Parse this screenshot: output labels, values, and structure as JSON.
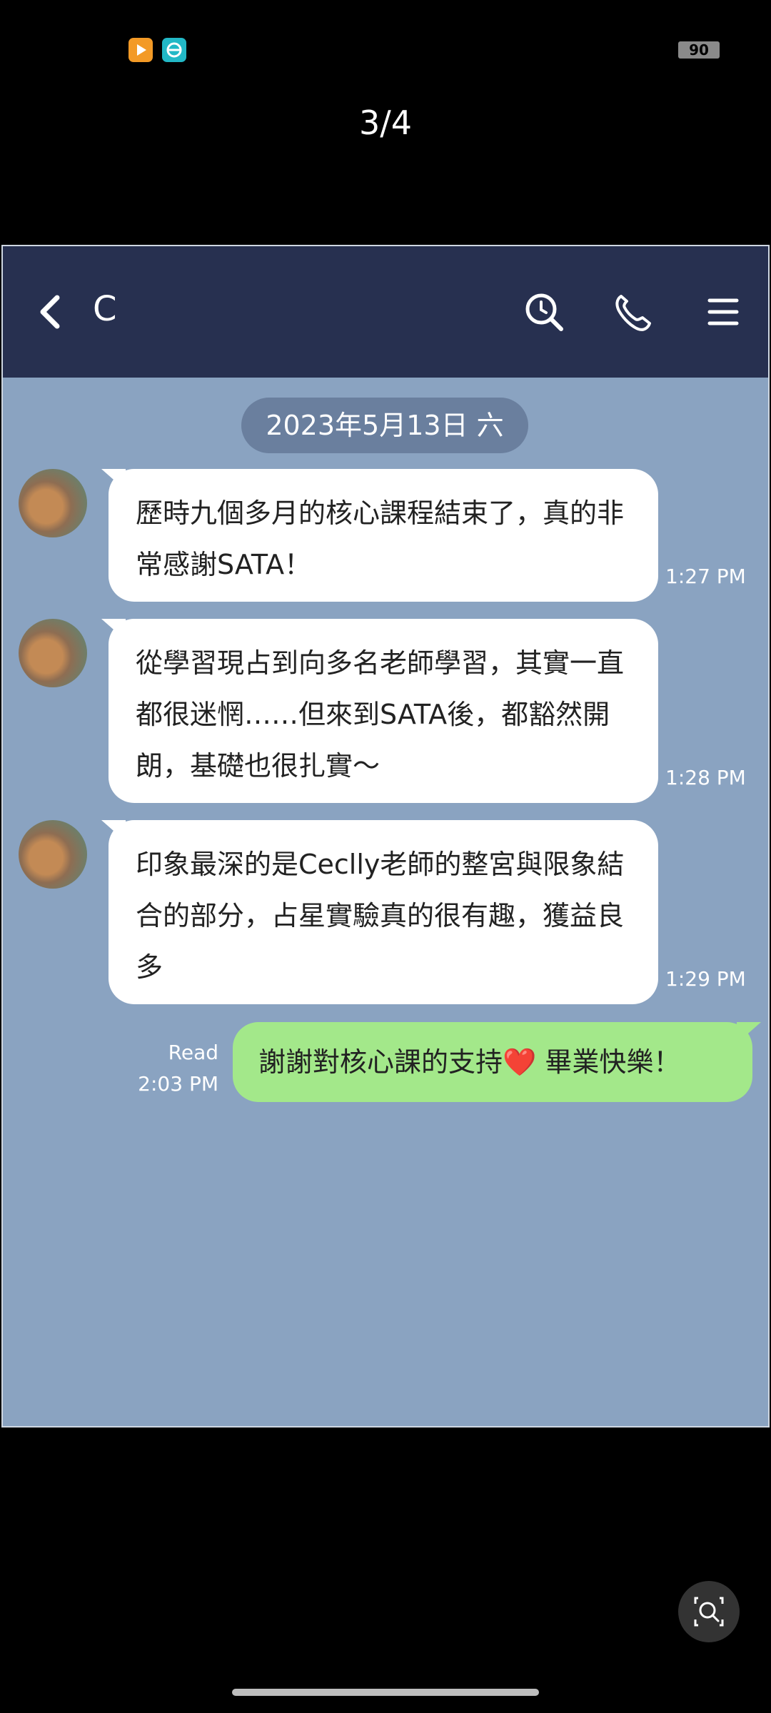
{
  "status_bar": {
    "apps": [
      "video-app-icon",
      "browser-app-icon"
    ],
    "battery": "90"
  },
  "viewer": {
    "page_counter": "3/4"
  },
  "chat": {
    "contact_name": "C",
    "date": "2023年5月13日 六",
    "messages": [
      {
        "text": "歷時九個多月的核心課程結束了，真的非常感謝SATA！",
        "time": "1:27 PM"
      },
      {
        "text": "從學習現占到向多名老師學習，其實一直都很迷惘……但來到SATA後，都豁然開朗，基礎也很扎實～",
        "time": "1:28 PM"
      },
      {
        "text": "印象最深的是Ceclly老師的整宮與限象結合的部分，占星實驗真的很有趣，獲益良多",
        "time": "1:29 PM"
      }
    ],
    "outgoing": {
      "text": "謝謝對核心課的支持❤️ 畢業快樂！",
      "read": "Read",
      "time": "2:03 PM"
    }
  },
  "colors": {
    "header_bg": "#273050",
    "chat_bg": "#8aa3c1",
    "incoming_bubble": "#ffffff",
    "outgoing_bubble": "#a3e88a"
  }
}
